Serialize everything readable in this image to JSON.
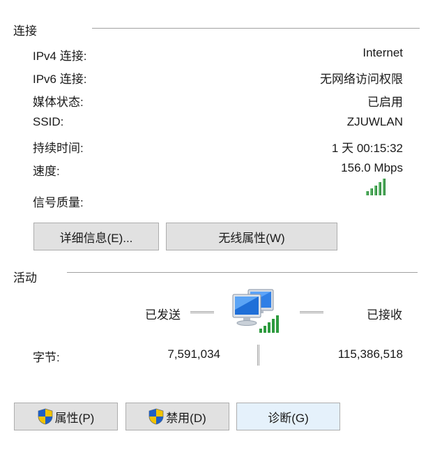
{
  "connection": {
    "title": "连接",
    "rows": [
      {
        "label": "IPv4 连接:",
        "value": "Internet"
      },
      {
        "label": "IPv6 连接:",
        "value": "无网络访问权限"
      },
      {
        "label": "媒体状态:",
        "value": "已启用"
      },
      {
        "label": "SSID:",
        "value": "ZJUWLAN"
      },
      {
        "label": "持续时间:",
        "value": "1 天 00:15:32"
      },
      {
        "label": "速度:",
        "value": "156.0 Mbps"
      }
    ],
    "signal_label": "信号质量:",
    "signal_icon": "signal-bars-icon",
    "buttons": {
      "details": "详细信息(E)...",
      "wireless_props": "无线属性(W)"
    }
  },
  "activity": {
    "title": "活动",
    "sent_label": "已发送",
    "received_label": "已接收",
    "network_icon": "network-computers-icon",
    "bytes_label": "字节:",
    "bytes_sent": "7,591,034",
    "bytes_received": "115,386,518"
  },
  "footer_buttons": {
    "properties": "属性(P)",
    "disable": "禁用(D)",
    "diagnose": "诊断(G)"
  },
  "colors": {
    "signal_green": "#2e9b3f",
    "button_bg": "#e1e1e1",
    "button_focus_bg": "#e5f1fb",
    "rule": "#a0a0a0"
  }
}
